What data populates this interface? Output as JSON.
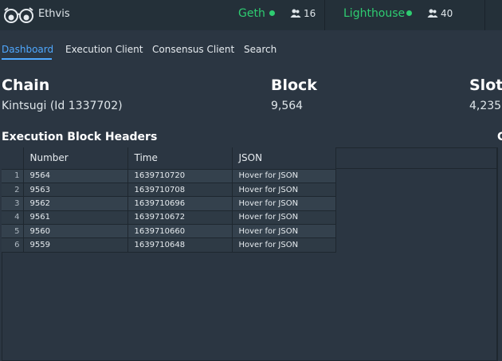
{
  "app": {
    "title": "Ethvis"
  },
  "clients": [
    {
      "name": "Geth",
      "status_color": "#2ecc71",
      "peers": "16"
    },
    {
      "name": "Lighthouse",
      "status_color": "#2ecc71",
      "peers": "40"
    }
  ],
  "nav": {
    "tabs": [
      {
        "label": "Dashboard",
        "active": true
      },
      {
        "label": "Execution Client",
        "active": false
      },
      {
        "label": "Consensus Client",
        "active": false
      },
      {
        "label": "Search",
        "active": false
      }
    ]
  },
  "stats": {
    "chain": {
      "label": "Chain",
      "value": "Kintsugi (Id 1337702)"
    },
    "block": {
      "label": "Block",
      "value": "9,564"
    },
    "slot": {
      "label": "Slot",
      "value": "4,235"
    }
  },
  "execution_headers": {
    "title": "Execution Block Headers",
    "next_section_fragment": "C",
    "columns": [
      "Number",
      "Time",
      "JSON"
    ],
    "rows": [
      {
        "idx": "1",
        "number": "9564",
        "time": "1639710720",
        "json": "Hover for JSON"
      },
      {
        "idx": "2",
        "number": "9563",
        "time": "1639710708",
        "json": "Hover for JSON"
      },
      {
        "idx": "3",
        "number": "9562",
        "time": "1639710696",
        "json": "Hover for JSON"
      },
      {
        "idx": "4",
        "number": "9561",
        "time": "1639710672",
        "json": "Hover for JSON"
      },
      {
        "idx": "5",
        "number": "9560",
        "time": "1639710660",
        "json": "Hover for JSON"
      },
      {
        "idx": "6",
        "number": "9559",
        "time": "1639710648",
        "json": "Hover for JSON"
      }
    ]
  },
  "icons": {
    "logo": "glasses-logo",
    "peers": "people-icon",
    "status": "status-dot"
  }
}
